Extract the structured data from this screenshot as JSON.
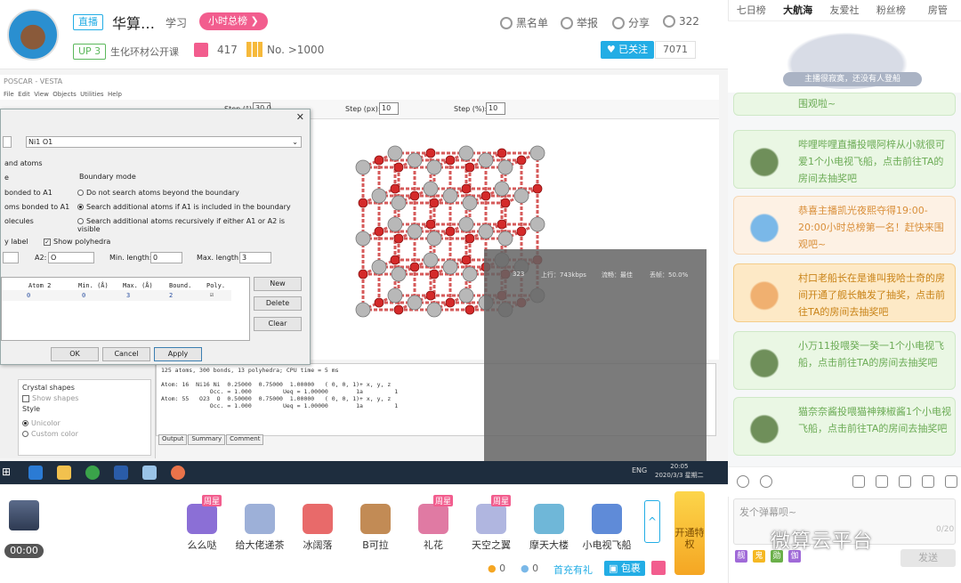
{
  "stream": {
    "live_label": "直播",
    "title": "华算…",
    "category": "学习",
    "hour_rank": "小时总榜 ❯",
    "up_level": "UP 3",
    "area": "生化环材公开课",
    "gift_count": "417",
    "rank": "No. >1000",
    "actions": {
      "blacklist": "黑名单",
      "report": "举报",
      "share": "分享",
      "viewers": "322"
    },
    "follow_label": "已关注",
    "follow_count": "7071"
  },
  "vesta": {
    "title": "POSCAR - VESTA",
    "menu": [
      "File",
      "Edit",
      "View",
      "Objects",
      "Utilities",
      "Help"
    ],
    "step_label": "Step (°):",
    "step_value": "30.0",
    "step_px_label": "Step (px):",
    "step_px_value": "10",
    "step_pct_label": "Step (%):",
    "step_pct_value": "10",
    "output_lines": "125 atoms, 300 bonds, 13 polyhedra; CPU time = 5 ms\n\nAtom: 16  Ni16 Ni  0.25000  0.75000  1.00000   ( 0, 0, 1)+ x, y, z\n              Occ. = 1.000         Ueq = 1.00000        1a         1\nAtom: 55   O23  O  0.50000  0.75000  1.00000   ( 0, 0, 1)+ x, y, z\n              Occ. = 1.000         Ueq = 1.00000        1a         1",
    "output_tabs": [
      "Output",
      "Summary",
      "Comment"
    ],
    "crystal_shapes": "Crystal shapes",
    "show_shapes": "Show shapes",
    "style": "Style",
    "unicolor": "Unicolor",
    "custom_color": "Custom color",
    "overlay_stats": {
      "a": "323",
      "up": "上行：743kbps",
      "fluency": "流畅：最佳",
      "loss": "丢帧：50.0%"
    }
  },
  "dialog": {
    "pair": "Ni1 O1",
    "section": "and atoms",
    "boundary_title": "Boundary mode",
    "left_opts": [
      "e",
      "bonded to A1",
      "oms bonded to A1",
      "olecules"
    ],
    "radios": [
      "Do not search atoms beyond the boundary",
      "Search additional atoms if A1 is included in the boundary",
      "Search additional atoms recursively if either A1 or A2 is visible"
    ],
    "label_opt": "y label",
    "show_polyhedra": "Show polyhedra",
    "a2_label": "A2:",
    "a2_value": "O",
    "min_label": "Min. length:",
    "min_value": "0",
    "max_label": "Max. length:",
    "max_value": "3",
    "table_headers": [
      "Atom 2",
      "Min. (Å)",
      "Max. (Å)",
      "Bound.",
      "Poly."
    ],
    "table_row": [
      "0",
      "0",
      "3",
      "2",
      "☑"
    ],
    "btn_new": "New",
    "btn_delete": "Delete",
    "btn_clear": "Clear",
    "btn_ok": "OK",
    "btn_cancel": "Cancel",
    "btn_apply": "Apply"
  },
  "taskbar": {
    "ime": "ENG",
    "time": "20:05",
    "date": "2020/3/3 星期二"
  },
  "gifts": {
    "timer": "00:00",
    "items": [
      {
        "name": "么么哒",
        "badge": "周星",
        "color": "#8b6fd6"
      },
      {
        "name": "给大佬递茶",
        "badge": "",
        "color": "#9db0d8"
      },
      {
        "name": "冰阔落",
        "badge": "",
        "color": "#e86a6a"
      },
      {
        "name": "B可拉",
        "badge": "",
        "color": "#c28b55"
      },
      {
        "name": "礼花",
        "badge": "周星",
        "color": "#e07aa3"
      },
      {
        "name": "天空之翼",
        "badge": "周星",
        "color": "#b0b6e0"
      },
      {
        "name": "摩天大楼",
        "badge": "",
        "color": "#6fb7d8"
      },
      {
        "name": "小电视飞船",
        "badge": "",
        "color": "#5f8bd8"
      }
    ],
    "more": "^",
    "open_privilege": "开通特权",
    "coin_gold": "0",
    "coin_silver": "0",
    "recharge": "首充有礼",
    "package": "▣ 包裹"
  },
  "right": {
    "tabs": [
      "七日榜",
      "大航海",
      "友爱社",
      "粉丝榜",
      "房管"
    ],
    "active_tab": "大航海",
    "mascot_text": "主播很寂寞，还没有人登船",
    "cards": [
      {
        "lines": "围观啦~",
        "style": "green"
      },
      {
        "lines": "哔哩哔哩直播投喂阿梓从小就很可爱1个小电视飞船，点击前往TA的房间去抽奖吧",
        "style": "green"
      },
      {
        "lines": "恭喜主播凯光夜熙夺得19:00-20:00小时总榜第一名！赶快来围观吧~",
        "style": "orange"
      },
      {
        "lines": "村口老船长在是谁叫我哈士奇的房间开通了舰长触发了抽奖，点击前往TA的房间去抽奖吧",
        "style": "amber"
      },
      {
        "lines": "小万11投喂癸一癸一1个小电视飞船，点击前往TA的房间去抽奖吧",
        "style": "green"
      },
      {
        "lines": "猫奈奈酱投喂猫神辣椒酱1个小电视飞船，点击前往TA的房间去抽奖吧",
        "style": "green"
      }
    ],
    "danmu_placeholder": "发个弹幕呗~",
    "danmu_count": "0/20",
    "send": "发送",
    "mini_tags": [
      "舰",
      "鬼",
      "勋",
      "伽"
    ]
  },
  "watermark": "微算云平台"
}
